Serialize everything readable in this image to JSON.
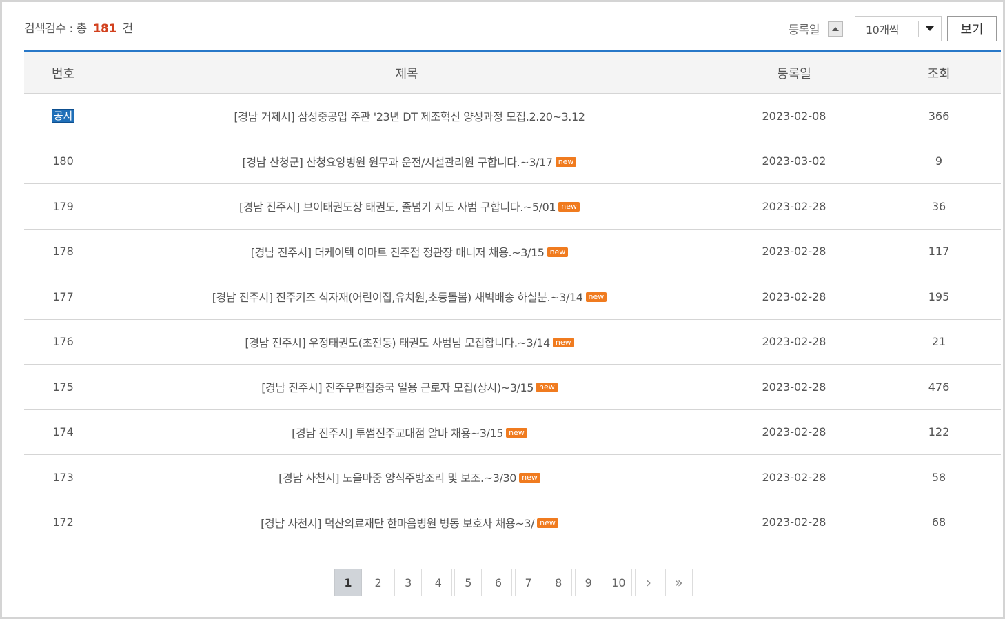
{
  "summary": {
    "label": "검색검수 : 총",
    "count": "181",
    "unit": "건"
  },
  "controls": {
    "sort_label": "등록일",
    "per_page": "10개씩",
    "view_button": "보기"
  },
  "table": {
    "headers": {
      "no": "번호",
      "title": "제목",
      "date": "등록일",
      "views": "조회"
    },
    "rows": [
      {
        "no": "",
        "notice": "공지",
        "title": "[경남 거제시] 삼성중공업 주관 '23년 DT 제조혁신 양성과정 모집.2.20~3.12",
        "new": "",
        "date": "2023-02-08",
        "views": "366"
      },
      {
        "no": "180",
        "notice": "",
        "title": "[경남 산청군] 산청요양병원 원무과 운전/시설관리원 구합니다.~3/17",
        "new": "new",
        "date": "2023-03-02",
        "views": "9"
      },
      {
        "no": "179",
        "notice": "",
        "title": "[경남 진주시] 브이태권도장 태권도, 줄넘기 지도 사범 구합니다.~5/01",
        "new": "new",
        "date": "2023-02-28",
        "views": "36"
      },
      {
        "no": "178",
        "notice": "",
        "title": "[경남 진주시] 더케이텍 이마트 진주점 정관장 매니저 채용.~3/15",
        "new": "new",
        "date": "2023-02-28",
        "views": "117"
      },
      {
        "no": "177",
        "notice": "",
        "title": "[경남 진주시] 진주키즈 식자재(어린이집,유치원,초등돌봄) 새벽배송 하실분.~3/14",
        "new": "new",
        "date": "2023-02-28",
        "views": "195"
      },
      {
        "no": "176",
        "notice": "",
        "title": "[경남 진주시] 우정태권도(초전동) 태권도 사범님 모집합니다.~3/14",
        "new": "new",
        "date": "2023-02-28",
        "views": "21"
      },
      {
        "no": "175",
        "notice": "",
        "title": "[경남 진주시] 진주우편집중국 일용 근로자 모집(상시)~3/15",
        "new": "new",
        "date": "2023-02-28",
        "views": "476"
      },
      {
        "no": "174",
        "notice": "",
        "title": "[경남 진주시] 투썸진주교대점 알바 채용~3/15",
        "new": "new",
        "date": "2023-02-28",
        "views": "122"
      },
      {
        "no": "173",
        "notice": "",
        "title": "[경남 사천시] 노을마중 양식주방조리 및 보조.~3/30",
        "new": "new",
        "date": "2023-02-28",
        "views": "58"
      },
      {
        "no": "172",
        "notice": "",
        "title": "[경남 사천시] 덕산의료재단 한마음병원 병동 보호사 채용~3/",
        "new": "new",
        "date": "2023-02-28",
        "views": "68"
      }
    ]
  },
  "pagination": {
    "pages": [
      "1",
      "2",
      "3",
      "4",
      "5",
      "6",
      "7",
      "8",
      "9",
      "10"
    ],
    "current": "1",
    "next": "›",
    "last": "»"
  }
}
